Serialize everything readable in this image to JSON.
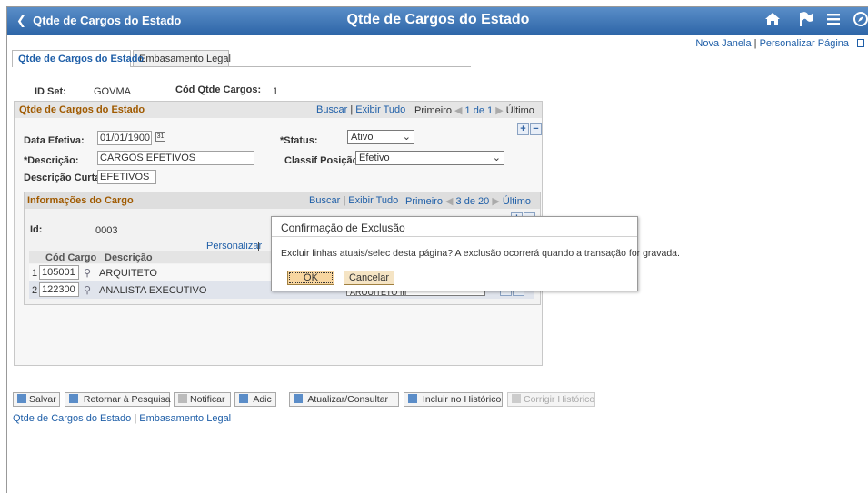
{
  "header": {
    "back_label": "Qtde de Cargos do Estado",
    "title": "Qtde de Cargos do Estado"
  },
  "top_links": {
    "new_window": "Nova Janela",
    "customize_page": "Personalizar Página",
    "sep": "|"
  },
  "tabs": [
    {
      "label": "Qtde de Cargos do Estado"
    },
    {
      "label": "Embasamento Legal"
    }
  ],
  "key": {
    "setid_label": "ID Set:",
    "setid_value": "GOVMA",
    "count_label": "Cód Qtde Cargos:",
    "count_value": "1"
  },
  "section": {
    "title": "Qtde de Cargos do Estado",
    "nav": {
      "find": "Buscar",
      "view_all": "Exibir Tudo",
      "first": "Primeiro",
      "position": "1 de 1",
      "last": "Último",
      "sep": "|"
    },
    "effdt_label": "Data Efetiva:",
    "effdt_value": "01/01/1900",
    "status_label": "*Status:",
    "status_value": "Ativo",
    "descr_label": "*Descrição:",
    "descr_value": "CARGOS EFETIVOS",
    "posclass_label": "Classif Posição:",
    "posclass_value": "Efetivo",
    "short_label": "Descrição Curta:",
    "short_value": "EFETIVOS"
  },
  "subsection": {
    "title": "Informações do Cargo",
    "nav": {
      "find": "Buscar",
      "view_all": "Exibir Tudo",
      "first": "Primeiro",
      "position": "3 de 20",
      "last": "Último",
      "sep": "|"
    },
    "id_label": "Id:",
    "id_value": "0003",
    "grid_customize": "Personalizar",
    "grid_sep": "|",
    "columns": {
      "code": "Cód Cargo",
      "descr": "Descrição"
    },
    "rows": [
      {
        "num": "1",
        "code": "105001",
        "descr": "ARQUITETO",
        "select": ""
      },
      {
        "num": "2",
        "code": "122300",
        "descr": "ANALISTA EXECUTIVO",
        "select": "ARQUITETO III"
      }
    ]
  },
  "toolbar": {
    "save": "Salvar",
    "return": "Retornar à Pesquisa",
    "notify": "Notificar",
    "add": "Adic",
    "update": "Atualizar/Consultar",
    "include_history": "Incluir no Histórico",
    "correct_history": "Corrigir Histórico"
  },
  "bottom_links": {
    "tab1": "Qtde de Cargos do Estado",
    "sep": "|",
    "tab2": "Embasamento Legal"
  },
  "dialog": {
    "title": "Confirmação de Exclusão",
    "message": "Excluir linhas atuais/selec desta página? A exclusão ocorrerá quando a transação for gravada.",
    "ok": "OK",
    "cancel": "Cancelar"
  },
  "icons": {
    "home": "home-icon",
    "flag": "flag-icon",
    "menu": "hamburger-menu-icon",
    "navbar": "compass-icon",
    "calendar": "calendar-icon",
    "lookup": "magnifier-icon"
  },
  "colors": {
    "header": "#2e66a8",
    "section_title": "#a05a00",
    "link": "#1f5fa8"
  }
}
